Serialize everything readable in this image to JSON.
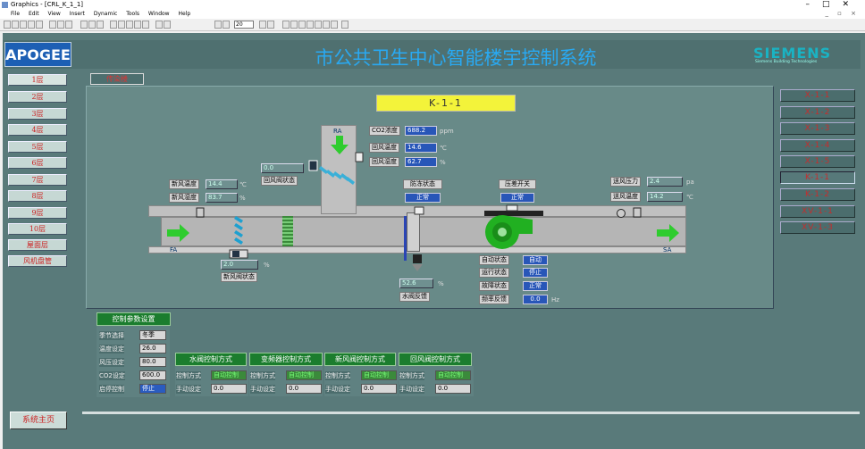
{
  "window": {
    "title": "Graphics - [CRL_K_1_1]"
  },
  "menu": [
    "File",
    "Edit",
    "View",
    "Insert",
    "Dynamic",
    "Tools",
    "Window",
    "Help"
  ],
  "toolbar": {
    "zoom": "20"
  },
  "header": {
    "brand": "APOGEE",
    "title": "市公共卫生中心智能楼宇控制系统",
    "logo": "SIEMENS",
    "logo_sub": "Siemens Building Technologies"
  },
  "floors": [
    "1层",
    "2层",
    "3层",
    "4层",
    "5层",
    "6层",
    "7层",
    "8层",
    "9层",
    "10层",
    "屋面层",
    "风机盘管"
  ],
  "home_button": "系统主页",
  "tab": "传染楼",
  "unit_name": "K-1-1",
  "units": [
    "X-1-1",
    "X-1-2",
    "X-1-3",
    "X-1-4",
    "X-1-5",
    "K-1-1",
    "K-1-2",
    "XV-1-1",
    "XV-1-3"
  ],
  "selected_unit": "K-1-1",
  "readings": {
    "fresh_temp": {
      "label": "新风温度",
      "value": "14.4",
      "unit": "℃"
    },
    "fresh_hum": {
      "label": "新风湿度",
      "value": "83.7",
      "unit": "%"
    },
    "return_damper_val": "0.0",
    "return_damper_label": "回风阀状态",
    "co2": {
      "label": "CO2浓度",
      "value": "688.2",
      "unit": "ppm"
    },
    "return_temp": {
      "label": "回风温度",
      "value": "14.6",
      "unit": "℃"
    },
    "return_hum": {
      "label": "回风湿度",
      "value": "62.7",
      "unit": "%"
    },
    "freeze": {
      "label": "防冻状态",
      "value": "正常"
    },
    "pressure_switch": {
      "label": "压差开关",
      "value": "正常"
    },
    "supply_pressure": {
      "label": "送风压力",
      "value": "2.4",
      "unit": "pa"
    },
    "supply_temp": {
      "label": "送风温度",
      "value": "14.2",
      "unit": "℃"
    },
    "fresh_damper_val": "2.0",
    "fresh_damper_unit": "%",
    "fresh_damper_label": "新风阀状态",
    "water_valve_val": "52.6",
    "water_valve_unit": "%",
    "water_valve_label": "水阀反馈",
    "fan_auto": {
      "label": "自动状态",
      "value": "自动"
    },
    "fan_run": {
      "label": "运行状态",
      "value": "停止"
    },
    "fan_fault": {
      "label": "故障状态",
      "value": "正常"
    },
    "fan_freq": {
      "label": "频率反馈",
      "value": "0.0",
      "unit": "Hz"
    },
    "fa": "FA",
    "sa": "SA",
    "ra": "RA"
  },
  "settings": {
    "header": "控制参数设置",
    "rows": [
      {
        "label": "季节选择",
        "value": "冬季"
      },
      {
        "label": "温度设定",
        "value": "26.0"
      },
      {
        "label": "风压设定",
        "value": "80.0"
      },
      {
        "label": "CO2设定",
        "value": "600.0"
      },
      {
        "label": "启停控制",
        "value": "停止"
      }
    ]
  },
  "control_modes": [
    {
      "header": "水阀控制方式",
      "mode_label": "控制方式",
      "mode_value": "自动控制",
      "manual_label": "手动设定",
      "manual_value": "0.0"
    },
    {
      "header": "变频器控制方式",
      "mode_label": "控制方式",
      "mode_value": "自动控制",
      "manual_label": "手动设定",
      "manual_value": "0.0"
    },
    {
      "header": "新风阀控制方式",
      "mode_label": "控制方式",
      "mode_value": "自动控制",
      "manual_label": "手动设定",
      "manual_value": "0.0"
    },
    {
      "header": "回风阀控制方式",
      "mode_label": "控制方式",
      "mode_value": "自动控制",
      "manual_label": "手动设定",
      "manual_value": "0.0"
    }
  ]
}
